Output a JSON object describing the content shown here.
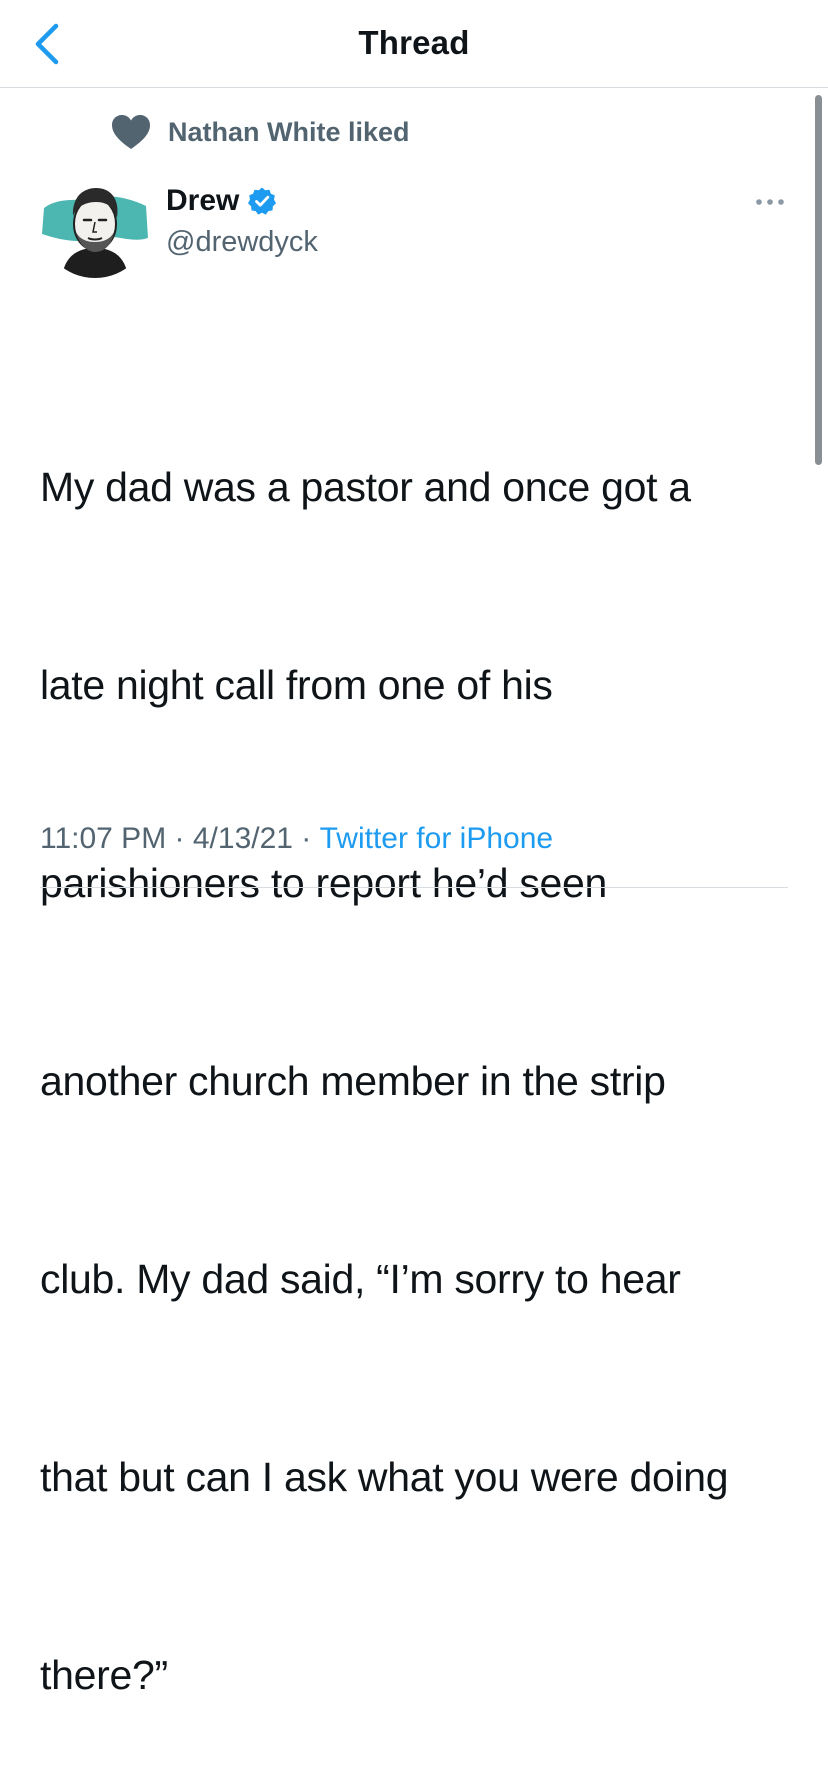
{
  "header": {
    "title": "Thread",
    "back_icon": "chevron-left-icon"
  },
  "social_context": {
    "icon": "heart-icon",
    "text": "Nathan White liked"
  },
  "tweet": {
    "author_name": "Drew",
    "author_handle": "@drewdyck",
    "verified_icon": "verified-badge-icon",
    "more_icon": "more-options-icon",
    "text_lines": [
      "My dad was a pastor and once got a",
      "late night call from one of his",
      "parishioners to report he’d seen",
      "another church member in the strip",
      "club. My dad said, “I’m sorry to hear",
      "that but can I ask what you were doing",
      "there?”"
    ],
    "time": "11:07 PM",
    "separator": " · ",
    "date": "4/13/21",
    "source": "Twitter for iPhone"
  },
  "colors": {
    "accent": "#1d9bf0",
    "secondary_text": "#536471",
    "heart_fill": "#536471",
    "divider": "#d8dde1"
  }
}
